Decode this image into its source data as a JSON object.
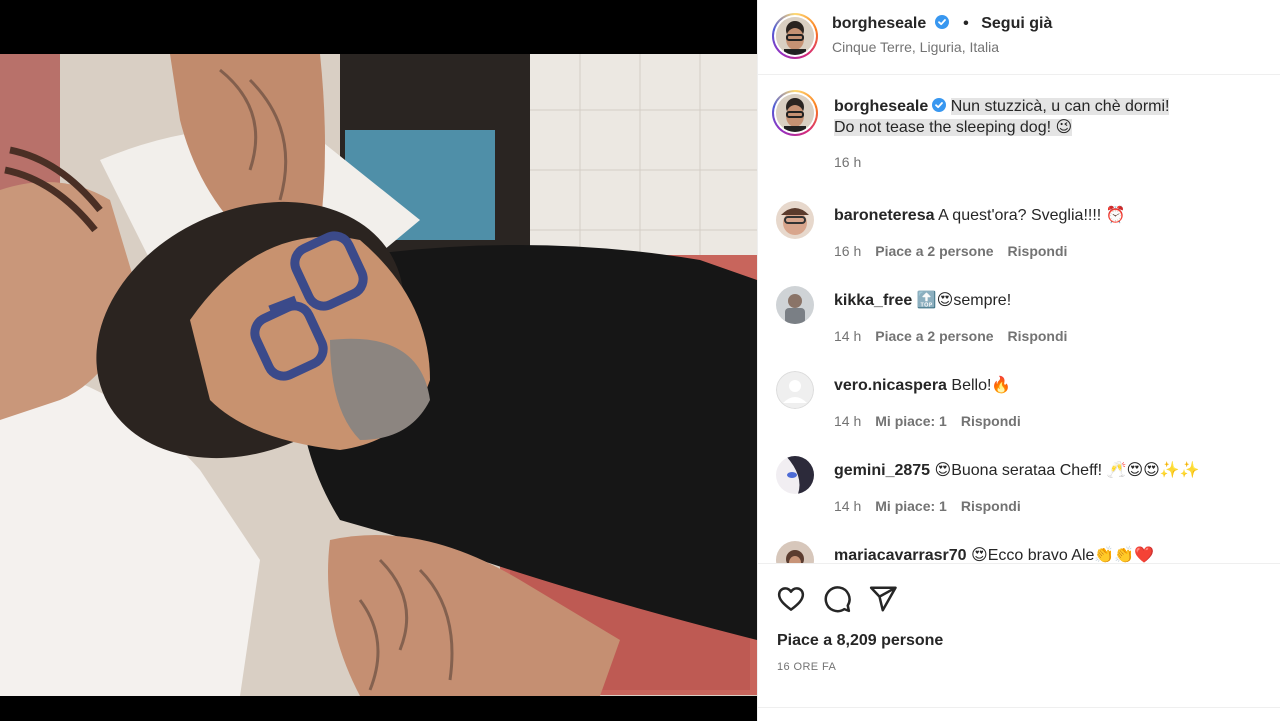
{
  "post": {
    "username": "borgheseale",
    "follow_label": "Segui già",
    "location": "Cinque Terre, Liguria, Italia",
    "caption_line1": "Nun stuzzicà, u can chè dormi!",
    "caption_line2": "Do not tease the sleeping dog! 😉",
    "caption_time": "16 h"
  },
  "comments": [
    {
      "username": "baroneteresa",
      "text": "A quest'ora? Sveglia!!!! ⏰",
      "time": "16 h",
      "likes": "Piace a 2 persone",
      "reply": "Rispondi"
    },
    {
      "username": "kikka_free",
      "text": "🔝😍sempre!",
      "time": "14 h",
      "likes": "Piace a 2 persone",
      "reply": "Rispondi"
    },
    {
      "username": "vero.nicaspera",
      "text": "Bello!🔥",
      "time": "14 h",
      "likes": "Mi piace: 1",
      "reply": "Rispondi"
    },
    {
      "username": "gemini_2875",
      "text": "😍Buona serataa Cheff! 🥂😍😍✨✨",
      "time": "14 h",
      "likes": "Mi piace: 1",
      "reply": "Rispondi"
    },
    {
      "username": "mariacavarrasr70",
      "text": "😍Ecco bravo Ale👏👏❤️",
      "time": "",
      "likes": "",
      "reply": ""
    }
  ],
  "footer": {
    "likes_text": "Piace a 8,209 persone",
    "posted_ago": "16 ORE FA"
  },
  "icons": [
    "verified-icon",
    "heart-icon",
    "comment-icon",
    "share-icon"
  ],
  "colors": {
    "verified": "#3897f0",
    "muted": "#737373",
    "text": "#262626"
  }
}
